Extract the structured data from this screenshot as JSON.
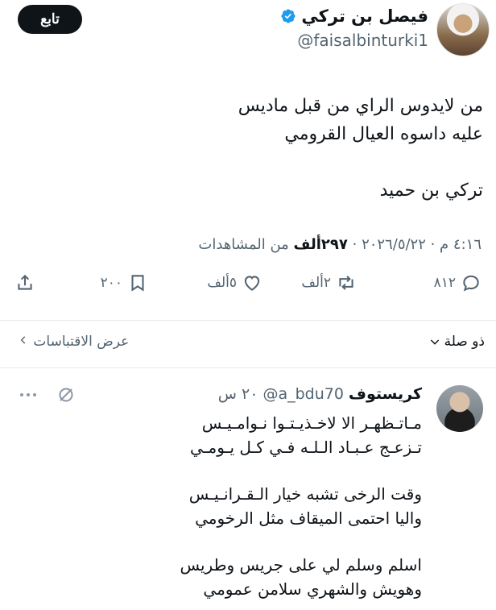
{
  "author": {
    "display_name": "فيصل بن تركي",
    "handle": "@faisalbinturki1",
    "follow_label": "تابع"
  },
  "tweet": {
    "lines": [
      "من لايدوس الراي من قبل ماديس",
      "عليه داسوه العيال القرومي",
      "",
      "تركي بن حميد"
    ],
    "timestamp": "٤:١٦ م · ٢٠٢٦/٥/٢٢",
    "views_count": "٢٩٧ألف",
    "views_label": "من المشاهدات"
  },
  "actions": {
    "replies": "٨١٢",
    "retweets": "٢ألف",
    "likes": "٥ألف",
    "bookmarks": "٢٠٠"
  },
  "context": {
    "relevant_label": "ذو صلة",
    "quotes_label": "عرض الاقتباسات"
  },
  "reply": {
    "name": "كريستوف",
    "handle": "@a_bdu70",
    "time": "٢٠ س",
    "lines": [
      "مـاتـظهـر الا لاخـذيـتـوا نـوامـيـس",
      "تـزعـج عـبـاد الـلـه فـي كـل يـومـي",
      "",
      "وقت الرخى تشبه خيار الـقـرانـيـس",
      "واليا احتمى الميقاف مثل الرخومي",
      "",
      "اسلم وسلم لي على جريس وطريس",
      "وهويش والشهري سلامن عمومي"
    ]
  },
  "colors": {
    "text": "#0f1419",
    "secondary": "#536471",
    "verified": "#1d9bf0",
    "follow_bg": "#0f1419"
  },
  "icons": [
    "verified-badge-icon",
    "reply-icon",
    "retweet-icon",
    "like-icon",
    "bookmark-icon",
    "share-icon",
    "chevron-down-icon",
    "chevron-left-icon",
    "grok-icon",
    "more-icon"
  ]
}
